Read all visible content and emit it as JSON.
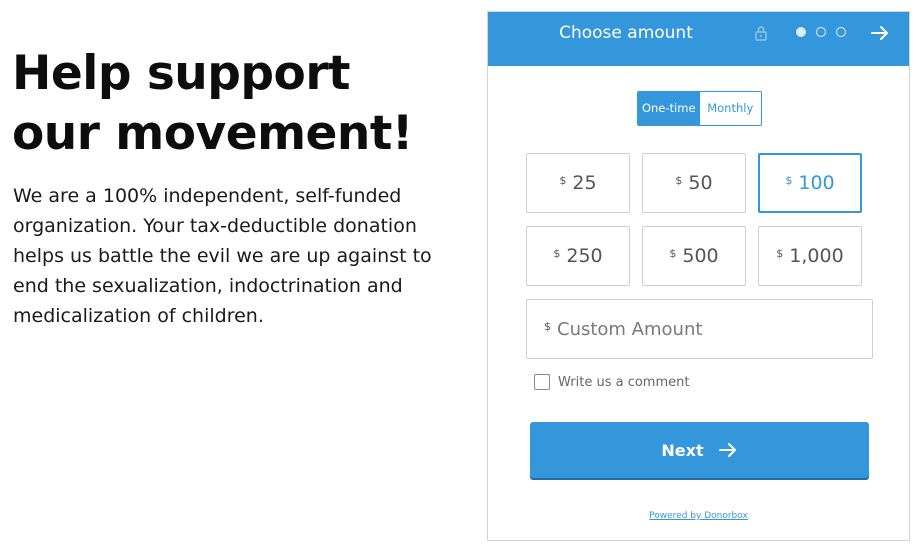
{
  "hero": {
    "headline_line1": "Help support",
    "headline_line2": "our movement!",
    "intro": "We are a 100% independent, self-funded organization. Your tax-deductible donation helps us battle the evil we are up against to end the sexualization, indoctrination and medicalization of children."
  },
  "widget": {
    "title": "Choose amount",
    "steps": {
      "total": 3,
      "current": 1
    },
    "header_icons": [
      "lock-icon",
      "arrow-right-icon"
    ],
    "frequency": {
      "options": [
        "One-time",
        "Monthly"
      ],
      "selected": "One-time"
    },
    "currency_symbol": "$",
    "amounts": [
      "25",
      "50",
      "100",
      "250",
      "500",
      "1,000"
    ],
    "selected_amount": "100",
    "custom_amount_placeholder": "Custom Amount",
    "comment_label": "Write us a comment",
    "comment_checked": false,
    "next_label": "Next",
    "powered_by": "Powered by Donorbox"
  },
  "colors": {
    "brand": "#3597db",
    "text": "#111111",
    "border": "#cfcfcf"
  }
}
